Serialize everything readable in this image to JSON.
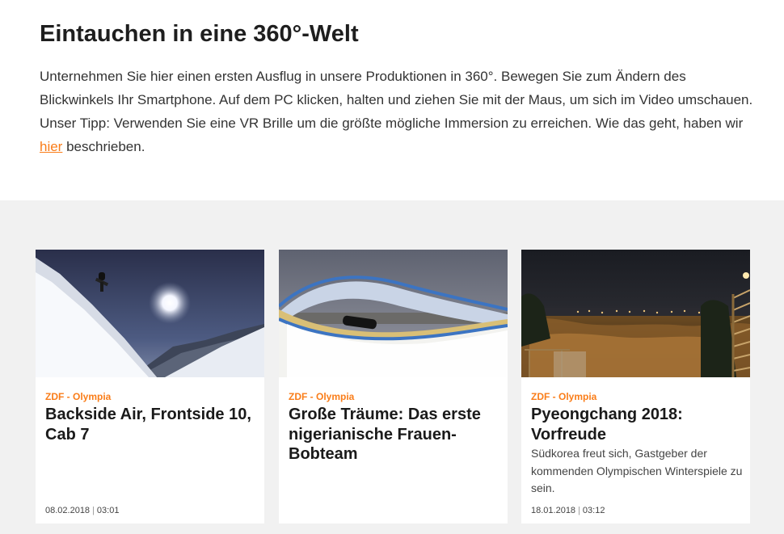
{
  "intro": {
    "heading": "Eintauchen in eine 360°-Welt",
    "text_before_link": "Unternehmen Sie hier einen ersten Ausflug in unsere Produktionen in 360°. Bewegen Sie zum Ändern des Blickwinkels Ihr Smartphone. Auf dem PC klicken, halten und ziehen Sie mit der Maus, um sich im Video umschauen. Unser Tipp: Verwenden Sie eine VR Brille um die größte mögliche Immersion zu erreichen. Wie das geht, haben wir ",
    "link_label": "hier",
    "text_after_link": " beschrieben."
  },
  "accent_color": "#fa7d19",
  "cards": [
    {
      "kicker": "ZDF - Olympia",
      "title": "Backside Air, Frontside 10, Cab 7",
      "description": "",
      "date": "08.02.2018",
      "duration": "03:01",
      "image": "snowboard-jump-360-thumbnail"
    },
    {
      "kicker": "ZDF - Olympia",
      "title": "Große Träume: Das erste nigerianische Frauen-Bobteam",
      "description": "",
      "date": "",
      "duration": "",
      "image": "bobsleigh-track-360-thumbnail"
    },
    {
      "kicker": "ZDF - Olympia",
      "title": "Pyeongchang 2018: Vorfreude",
      "description": "Südkorea freut sich, Gastgeber der kommenden Olympischen Winterspiele zu sein.",
      "date": "18.01.2018",
      "duration": "03:12",
      "image": "night-city-panorama-thumbnail"
    }
  ]
}
